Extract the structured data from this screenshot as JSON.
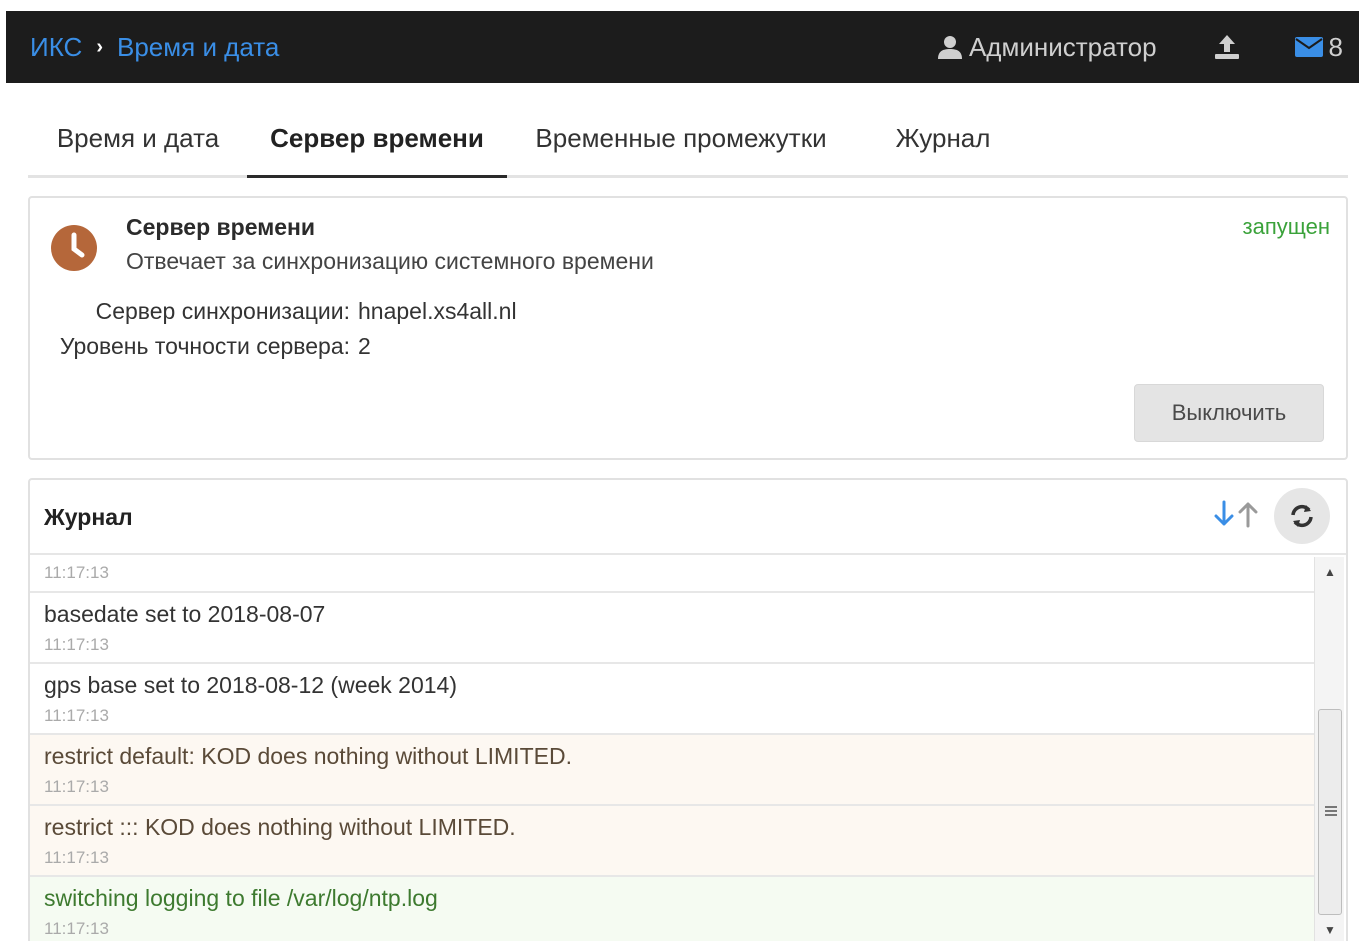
{
  "header": {
    "breadcrumb_root": "ИКС",
    "breadcrumb_separator": "›",
    "breadcrumb_current": "Время и дата",
    "user_name": "Администратор",
    "user_icon": "user-icon",
    "upload_icon": "upload-icon",
    "mail_icon": "envelope-icon",
    "mail_count": "8",
    "colors": {
      "background": "#1c1c1c",
      "link": "#3a8ee6"
    }
  },
  "tabs": [
    {
      "label": "Время и дата",
      "active": false
    },
    {
      "label": "Сервер времени",
      "active": true
    },
    {
      "label": "Временные промежутки",
      "active": false
    },
    {
      "label": "Журнал",
      "active": false
    }
  ],
  "service": {
    "icon": "clock-icon",
    "title": "Сервер времени",
    "description": "Отвечает за синхронизацию системного времени",
    "status": "запущен",
    "status_color": "#3aa23a",
    "fields": [
      {
        "label": "Сервер синхронизации:",
        "value": "hnapel.xs4all.nl"
      },
      {
        "label": "Уровень точности сервера:",
        "value": "2"
      }
    ],
    "disable_button": "Выключить"
  },
  "log": {
    "title": "Журнал",
    "sort_icon": "sort-arrows-icon",
    "refresh_icon": "refresh-icon",
    "entries": [
      {
        "message": "",
        "time": "11:17:13",
        "level": "normal"
      },
      {
        "message": "basedate set to 2018-08-07",
        "time": "11:17:13",
        "level": "normal"
      },
      {
        "message": "gps base set to 2018-08-12 (week 2014)",
        "time": "11:17:13",
        "level": "normal"
      },
      {
        "message": "restrict default: KOD does nothing without LIMITED.",
        "time": "11:17:13",
        "level": "warning"
      },
      {
        "message": "restrict ::: KOD does nothing without LIMITED.",
        "time": "11:17:13",
        "level": "warning"
      },
      {
        "message": "switching logging to file /var/log/ntp.log",
        "time": "11:17:13",
        "level": "success"
      }
    ]
  }
}
